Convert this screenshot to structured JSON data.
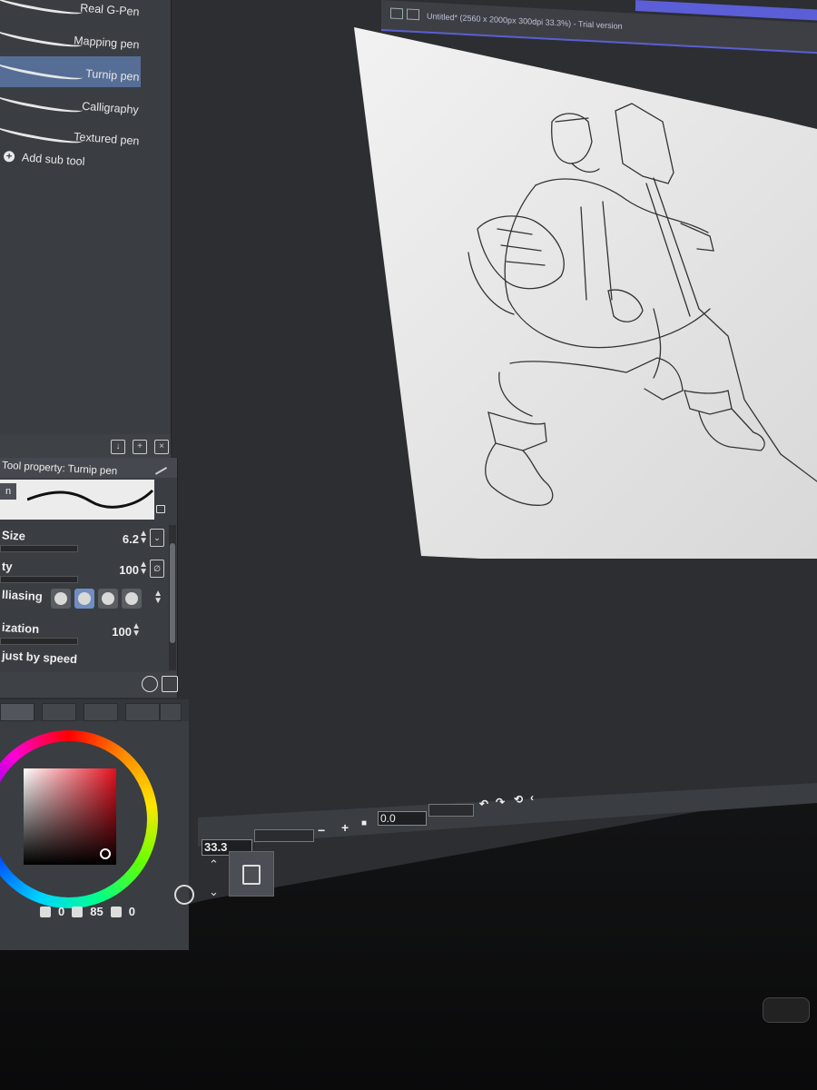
{
  "window": {
    "title": "Untitled* (2560 x 2000px 300dpi 33.3%) - Trial version"
  },
  "subtool_panel": {
    "items": [
      {
        "label": "Real G-Pen",
        "selected": false
      },
      {
        "label": "Mapping pen",
        "selected": false
      },
      {
        "label": "Turnip pen",
        "selected": true
      },
      {
        "label": "Calligraphy",
        "selected": false
      },
      {
        "label": "Textured pen",
        "selected": false
      }
    ],
    "add_sub_tool": "Add sub tool"
  },
  "tool_property": {
    "header": "Tool property: Turnip pen",
    "brush_tag": "n",
    "size": {
      "label": "Size",
      "value": "6.2"
    },
    "opacity": {
      "label": "ty",
      "value": "100"
    },
    "antialiasing": {
      "label": "lliasing",
      "selected_index": 1
    },
    "stabilization": {
      "label": "ization",
      "value": "100"
    },
    "adjust_speed": {
      "label": "just by speed"
    }
  },
  "color_panel": {
    "hue": "0",
    "saturation": "85",
    "value": "0",
    "accent": "#e5101e"
  },
  "navigator": {
    "zoom": "33.3",
    "angle": "0.0",
    "zoom_out": "−",
    "zoom_in": "+",
    "stop": "■"
  },
  "colors": {
    "selection": "#566e95",
    "title_accent": "#5a5fd0"
  }
}
